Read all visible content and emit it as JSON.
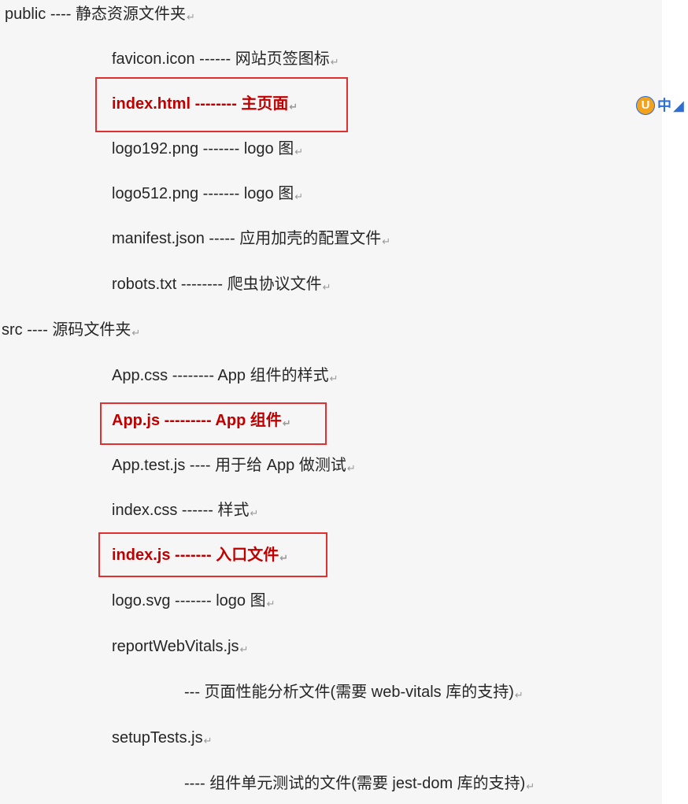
{
  "document": {
    "lines": [
      {
        "text": "public ---- 静态资源文件夹",
        "highlight": false
      },
      {
        "text": "favicon.icon ------ 网站页签图标",
        "highlight": false
      },
      {
        "text": "index.html -------- 主页面",
        "highlight": true
      },
      {
        "text": "logo192.png ------- logo 图",
        "highlight": false
      },
      {
        "text": "logo512.png ------- logo 图",
        "highlight": false
      },
      {
        "text": "manifest.json ----- 应用加壳的配置文件",
        "highlight": false
      },
      {
        "text": "robots.txt -------- 爬虫协议文件",
        "highlight": false
      },
      {
        "text": "src ---- 源码文件夹",
        "highlight": false
      },
      {
        "text": "App.css -------- App 组件的样式",
        "highlight": false
      },
      {
        "text": "App.js --------- App 组件",
        "highlight": true
      },
      {
        "text": "App.test.js ---- 用于给 App 做测试",
        "highlight": false
      },
      {
        "text": "index.css ------ 样式",
        "highlight": false
      },
      {
        "text": "index.js ------- 入口文件",
        "highlight": true
      },
      {
        "text": "logo.svg ------- logo 图",
        "highlight": false
      },
      {
        "text": "reportWebVitals.js",
        "highlight": false
      },
      {
        "text": "--- 页面性能分析文件(需要 web-vitals 库的支持)",
        "highlight": false
      },
      {
        "text": "setupTests.js",
        "highlight": false
      },
      {
        "text": "---- 组件单元测试的文件(需要 jest-dom 库的支持)",
        "highlight": false
      }
    ],
    "return_mark": "↵"
  },
  "ime_indicator": {
    "logo_letter": "U",
    "mode": "中",
    "moon": "◢"
  },
  "colors": {
    "text": "#262626",
    "highlight_text": "#c00000",
    "highlight_box": "#e03030",
    "page_bg": "#f6f6f6",
    "ime_blue": "#2c6dd6",
    "ime_orange": "#f2a21d"
  }
}
